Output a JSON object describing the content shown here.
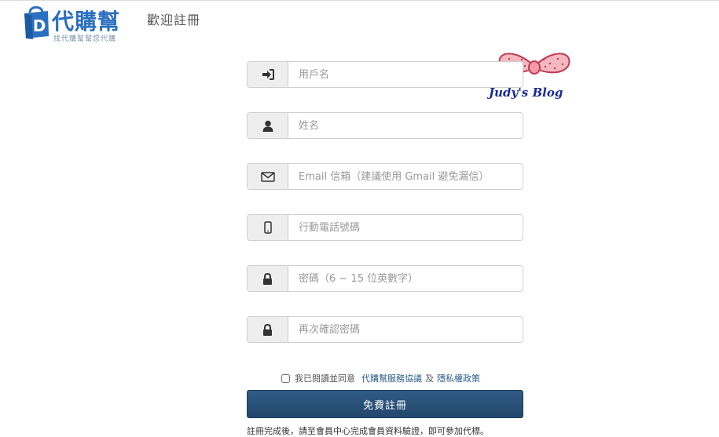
{
  "header": {
    "logo_name": "代購幫",
    "logo_slogan": "找代購幫幫您代購",
    "page_title": "歡迎註冊"
  },
  "watermark": {
    "text": "Judy's Blog"
  },
  "form": {
    "username": {
      "placeholder": "用戶名",
      "icon": "sign-in-icon"
    },
    "name": {
      "placeholder": "姓名",
      "icon": "user-icon"
    },
    "email": {
      "placeholder": "Email 信箱（建議使用 Gmail 避免漏信）",
      "icon": "envelope-icon"
    },
    "phone": {
      "placeholder": "行動電話號碼",
      "icon": "mobile-icon"
    },
    "password": {
      "placeholder": "密碼（6 ~ 15 位英數字）",
      "icon": "lock-icon"
    },
    "password_confirm": {
      "placeholder": "再次確認密碼",
      "icon": "lock-icon"
    }
  },
  "agreement": {
    "prefix": "我已閱讀並同意",
    "terms_link": "代購幫服務協議",
    "and": "及",
    "privacy_link": "隱私權政策"
  },
  "submit_label": "免費註冊",
  "note": "註冊完成後，請至會員中心完成會員資料驗證，即可參加代標。",
  "colors": {
    "brand": "#2b6fbf",
    "button": "#2a5179",
    "link": "#2b5d8a"
  }
}
